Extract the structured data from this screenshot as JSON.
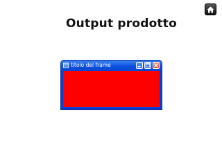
{
  "slide": {
    "title": "Output prodotto"
  },
  "nav": {
    "home_icon": "home-icon"
  },
  "window": {
    "title": "titolo del frame",
    "content_color": "#ff0000",
    "titlebar_color": "#0b50e0",
    "controls": [
      "minimize-icon",
      "maximize-icon",
      "close-icon"
    ]
  }
}
